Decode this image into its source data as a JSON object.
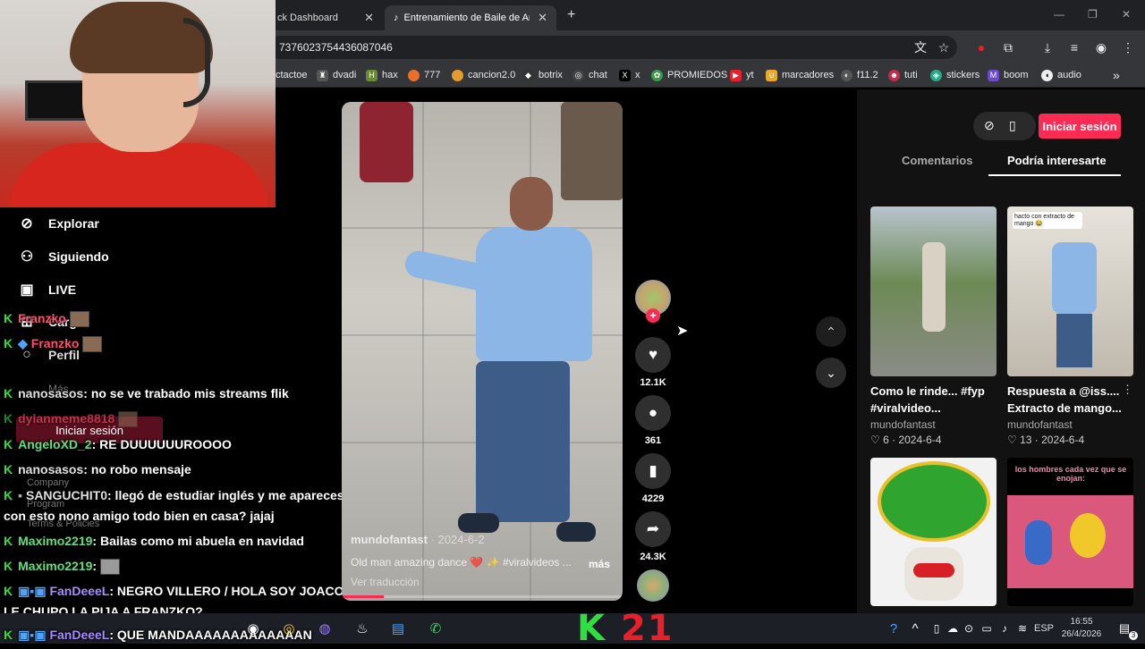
{
  "browser": {
    "tabs": [
      {
        "label": "ck Dashboard",
        "active": false
      },
      {
        "label": "Entrenamiento de Baile de Anc",
        "active": true
      }
    ],
    "url": "7376023754436087046",
    "bookmarks": [
      "ctactoe",
      "dvadi",
      "hax",
      "777",
      "cancion2.0",
      "botrix",
      "chat",
      "x",
      "PROMIEDOS",
      "yt",
      "marcadores",
      "f11.2",
      "tuti",
      "stickers",
      "boom",
      "audio"
    ]
  },
  "sidenav": {
    "items": [
      {
        "label": "Explorar",
        "icon": "compass-icon"
      },
      {
        "label": "Siguiendo",
        "icon": "following-icon"
      },
      {
        "label": "LIVE",
        "icon": "live-icon"
      },
      {
        "label": "Cargar",
        "icon": "upload-icon"
      },
      {
        "label": "Perfil",
        "icon": "profile-icon"
      }
    ],
    "more": "Más",
    "login": "Iniciar sesión",
    "company": "Company",
    "program": "Program",
    "terms": "Terms & Policies"
  },
  "chat": [
    {
      "user": "Franzko",
      "msg": ""
    },
    {
      "user": "Franzko",
      "msg": ""
    },
    {
      "user": "nanosasos",
      "msg": ": no se ve trabado mis streams flik"
    },
    {
      "user": "dylanmeme8818",
      "msg": ""
    },
    {
      "user": "AngeloXD_2",
      "msg": ": RE DUUUUUUROOOO"
    },
    {
      "user": "nanosasos",
      "msg": ": no robo mensaje"
    },
    {
      "user": "SANGUCHIT0",
      "msg": ": llegó de estudiar inglés y me apareces"
    },
    {
      "user": "",
      "msg": "con esto nono amigo todo bien en casa? jajaj"
    },
    {
      "user": "Maximo2219",
      "msg": ": Bailas como mi abuela en navidad"
    },
    {
      "user": "Maximo2219",
      "msg": ":"
    },
    {
      "user": "FanDeeeL",
      "msg": ": NEGRO VILLERO / HOLA SOY JOACO Y"
    },
    {
      "user": "",
      "msg": "LE CHUPO LA PIJA A FRANZKO?"
    },
    {
      "user": "FanDeeeL",
      "msg": ": QUE MANDAAAAAAAAAAAAAN"
    }
  ],
  "video": {
    "author": "mundofantast",
    "date": "· 2024-6-2",
    "description": "Old man amazing dance ❤️ ✨ #viralvideos ...",
    "more": "más",
    "translate": "Ver traducción",
    "progress": 0.15,
    "likes": "12.1K",
    "comments": "361",
    "saves": "4229",
    "shares": "24.3K"
  },
  "panel": {
    "login": "Iniciar sesión",
    "tabs": [
      "Comentarios",
      "Podría interesarte"
    ],
    "active_tab": "Podría interesarte",
    "cards": [
      {
        "title": "Como le rinde... #fyp",
        "title2": "#viralvideo...",
        "author": "mundofantast",
        "meta": "♡ 6 · 2024-6-4"
      },
      {
        "title": "Respuesta a @iss....",
        "title2": "Extracto de mango...",
        "author": "mundofantast",
        "meta": "♡ 13 · 2024-6-4",
        "overlay": "hacto con extracto de mango 😂"
      },
      {
        "overlay": ""
      },
      {
        "overlay": "los hombres cada vez que se enojan:"
      }
    ]
  },
  "taskbar": {
    "brand_k": "K",
    "brand_num": "21",
    "lang": "ESP",
    "time": "16:55",
    "date": "26/4/2026",
    "notif": "3"
  },
  "colors": {
    "accent": "#fe2c55",
    "kick": "#2ee03f"
  }
}
